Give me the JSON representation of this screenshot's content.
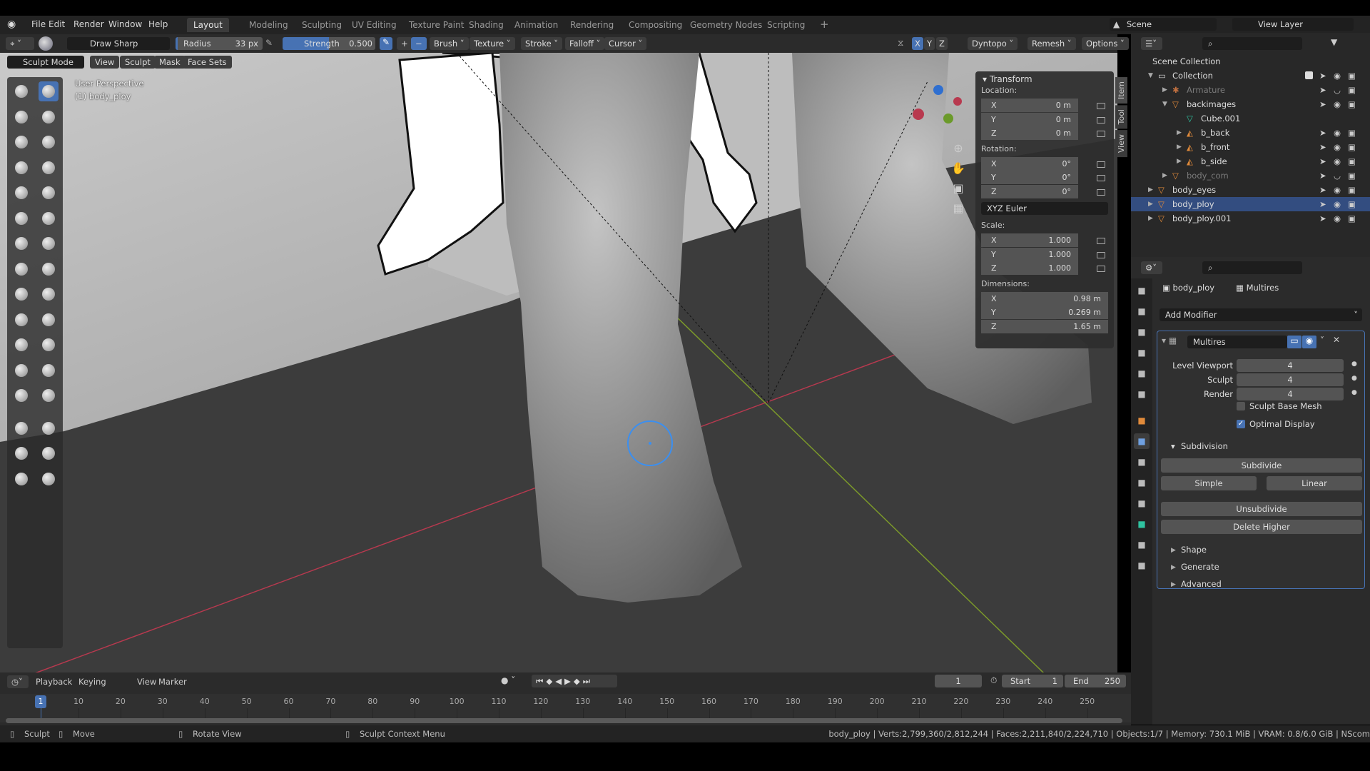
{
  "menu": {
    "items": [
      "File",
      "Edit",
      "Render",
      "Window",
      "Help"
    ]
  },
  "workspaces": [
    "Layout",
    "Modeling",
    "Sculpting",
    "UV Editing",
    "Texture Paint",
    "Shading",
    "Animation",
    "Rendering",
    "Compositing",
    "Geometry Nodes",
    "Scripting"
  ],
  "active_workspace": "Layout",
  "scene": {
    "name": "Scene",
    "view_layer": "View Layer"
  },
  "tool_header": {
    "brush_name": "Draw Sharp",
    "radius_label": "Radius",
    "radius_value": "33 px",
    "strength_label": "Strength",
    "strength_value": "0.500",
    "dropdowns": [
      "Brush",
      "Texture",
      "Stroke",
      "Falloff",
      "Cursor"
    ],
    "symmetry": [
      "X",
      "Y",
      "Z"
    ],
    "right_dropdowns": [
      "Dyntopo",
      "Remesh",
      "Options"
    ]
  },
  "viewport": {
    "mode": "Sculpt Mode",
    "menus": [
      "View",
      "Sculpt",
      "Mask",
      "Face Sets"
    ],
    "perspective": "User Perspective",
    "object_label": "(1) body_ploy"
  },
  "toolbar_tools": [
    "draw",
    "draw-sharp",
    "clay",
    "clay-strips",
    "clay-thumb",
    "layer",
    "inflate",
    "blob",
    "crease",
    "smooth",
    "flatten",
    "fill",
    "scrape",
    "multiplane-scrape",
    "pinch",
    "grab",
    "elastic-deform",
    "snake-hook",
    "thumb",
    "pose",
    "nudge",
    "rotate",
    "slide-relax",
    "boundary",
    "cloth",
    "simplify",
    "mask",
    "draw-face-sets",
    "multires-displacement-eraser",
    "multires-displacement-smear",
    "paint",
    "smear"
  ],
  "npanel": {
    "title": "Transform",
    "tabs": [
      "Item",
      "Tool",
      "View"
    ],
    "location_label": "Location:",
    "location": [
      {
        "axis": "X",
        "value": "0 m"
      },
      {
        "axis": "Y",
        "value": "0 m"
      },
      {
        "axis": "Z",
        "value": "0 m"
      }
    ],
    "rotation_label": "Rotation:",
    "rotation": [
      {
        "axis": "X",
        "value": "0°"
      },
      {
        "axis": "Y",
        "value": "0°"
      },
      {
        "axis": "Z",
        "value": "0°"
      }
    ],
    "rotation_mode": "XYZ Euler",
    "scale_label": "Scale:",
    "scale": [
      {
        "axis": "X",
        "value": "1.000"
      },
      {
        "axis": "Y",
        "value": "1.000"
      },
      {
        "axis": "Z",
        "value": "1.000"
      }
    ],
    "dimensions_label": "Dimensions:",
    "dimensions": [
      {
        "axis": "X",
        "value": "0.98 m"
      },
      {
        "axis": "Y",
        "value": "0.269 m"
      },
      {
        "axis": "Z",
        "value": "1.65 m"
      }
    ]
  },
  "outliner": {
    "root": "Scene Collection",
    "items": [
      {
        "name": "Collection",
        "depth": 0,
        "type": "collection"
      },
      {
        "name": "Armature",
        "depth": 1,
        "type": "armature",
        "dim": true
      },
      {
        "name": "backimages",
        "depth": 1,
        "type": "object"
      },
      {
        "name": "Cube.001",
        "depth": 2,
        "type": "mesh"
      },
      {
        "name": "b_back",
        "depth": 2,
        "type": "image"
      },
      {
        "name": "b_front",
        "depth": 2,
        "type": "image"
      },
      {
        "name": "b_side",
        "depth": 2,
        "type": "image"
      },
      {
        "name": "body_com",
        "depth": 1,
        "type": "object",
        "dim": true
      },
      {
        "name": "body_eyes",
        "depth": 0,
        "type": "object"
      },
      {
        "name": "body_ploy",
        "depth": 0,
        "type": "object",
        "selected": true
      },
      {
        "name": "body_ploy.001",
        "depth": 0,
        "type": "object"
      }
    ]
  },
  "properties": {
    "object": "body_ploy",
    "modifier_crumb": "Multires",
    "add_modifier": "Add Modifier",
    "modifier_name": "Multires",
    "levels": [
      {
        "label": "Level Viewport",
        "value": "4"
      },
      {
        "label": "Sculpt",
        "value": "4"
      },
      {
        "label": "Render",
        "value": "4"
      }
    ],
    "sculpt_base_mesh": {
      "label": "Sculpt Base Mesh",
      "checked": false
    },
    "optimal_display": {
      "label": "Optimal Display",
      "checked": true
    },
    "subdivision_label": "Subdivision",
    "subdivide": "Subdivide",
    "simple": "Simple",
    "linear": "Linear",
    "unsubdivide": "Unsubdivide",
    "delete_higher": "Delete Higher",
    "subpanels": [
      "Shape",
      "Generate",
      "Advanced"
    ]
  },
  "timeline": {
    "menus": [
      "Playback",
      "Keying",
      "View",
      "Marker"
    ],
    "current_frame": "1",
    "start_label": "Start",
    "start": "1",
    "end_label": "End",
    "end": "250",
    "ticks": [
      10,
      20,
      30,
      40,
      50,
      60,
      70,
      80,
      90,
      100,
      110,
      120,
      130,
      140,
      150,
      160,
      170,
      180,
      190,
      200,
      210,
      220,
      230,
      240,
      250
    ],
    "playhead": 1
  },
  "status": {
    "hints": [
      "Sculpt",
      "Move",
      "Rotate View",
      "Sculpt Context Menu"
    ],
    "stats": "body_ploy | Verts:2,799,360/2,812,244 | Faces:2,211,840/2,224,710 | Objects:1/7 | Memory: 730.1 MiB | VRAM: 0.8/6.0 GiB | NScom"
  },
  "colors": {
    "accent": "#4772b3",
    "selected_row": "#334d80",
    "x_axis": "#b8394f",
    "y_axis": "#7c9a2a",
    "brush_cursor": "#3b8ff0"
  }
}
